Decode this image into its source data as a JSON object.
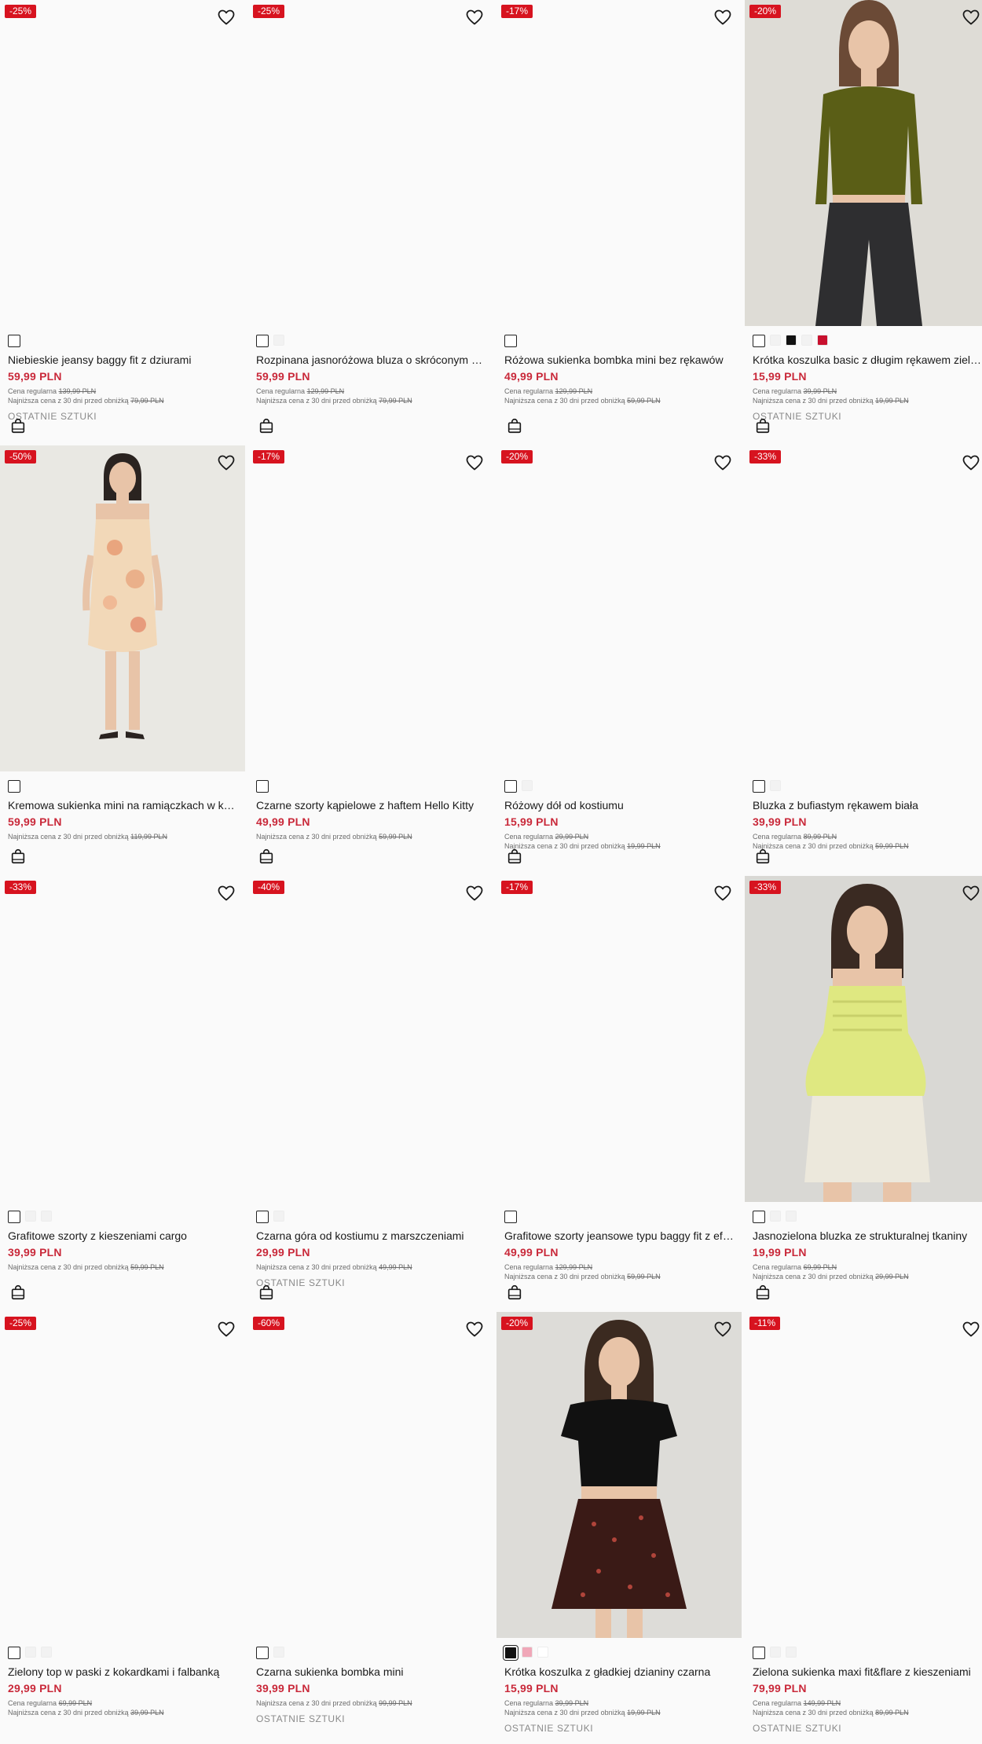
{
  "colors": {
    "badge": "#d7131f",
    "price": "#c9293a",
    "text": "#1a1a1a",
    "muted": "#6b6b6b"
  },
  "labels": {
    "regular_price": "Cena regularna",
    "lowest_price": "Najniższa cena z 30 dni przed obniżką",
    "last_items": "OSTATNIE SZTUKI"
  },
  "products": [
    {
      "discount": "-25%",
      "title": "Niebieskie jeansy baggy fit z dziurami",
      "price": "59,99 PLN",
      "regular": "139,99 PLN",
      "lowest": "79,99 PLN",
      "last": true,
      "photo": "",
      "swatches": [
        "#ffffff"
      ]
    },
    {
      "discount": "-25%",
      "title": "Rozpinana jasnoróżowa bluza o skróconym kroju",
      "price": "59,99 PLN",
      "regular": "129,99 PLN",
      "lowest": "79,99 PLN",
      "last": false,
      "photo": "",
      "swatches": [
        "#ffffff",
        "#f2f2f2"
      ]
    },
    {
      "discount": "-17%",
      "title": "Różowa sukienka bombka mini bez rękawów",
      "price": "49,99 PLN",
      "regular": "129,99 PLN",
      "lowest": "59,99 PLN",
      "last": false,
      "photo": "",
      "swatches": [
        "#ffffff"
      ]
    },
    {
      "discount": "-20%",
      "title": "Krótka koszulka basic z długim rękawem zielona",
      "price": "15,99 PLN",
      "regular": "39,99 PLN",
      "lowest": "19,99 PLN",
      "last": true,
      "photo": "olive-top",
      "swatches": [
        "#ffffff",
        "#f2f2f2",
        "#111111",
        "#f2f2f2",
        "#c8102e"
      ]
    },
    {
      "discount": "-50%",
      "title": "Kremowa sukienka mini na ramiączkach w kwiaty",
      "price": "59,99 PLN",
      "regular": null,
      "lowest": "119,99 PLN",
      "last": false,
      "photo": "floral-dress",
      "swatches": [
        "#ffffff"
      ]
    },
    {
      "discount": "-17%",
      "title": "Czarne szorty kąpielowe z haftem Hello Kitty",
      "price": "49,99 PLN",
      "regular": null,
      "lowest": "59,99 PLN",
      "last": false,
      "photo": "",
      "swatches": [
        "#ffffff"
      ]
    },
    {
      "discount": "-20%",
      "title": "Różowy dół od kostiumu",
      "price": "15,99 PLN",
      "regular": "29,99 PLN",
      "lowest": "19,99 PLN",
      "last": false,
      "photo": "",
      "swatches": [
        "#ffffff",
        "#f2f2f2"
      ]
    },
    {
      "discount": "-33%",
      "title": "Bluzka z bufiastym rękawem biała",
      "price": "39,99 PLN",
      "regular": "89,99 PLN",
      "lowest": "59,99 PLN",
      "last": false,
      "photo": "",
      "swatches": [
        "#ffffff",
        "#f2f2f2"
      ]
    },
    {
      "discount": "-33%",
      "title": "Grafitowe szorty z kieszeniami cargo",
      "price": "39,99 PLN",
      "regular": null,
      "lowest": "59,99 PLN",
      "last": false,
      "photo": "",
      "swatches": [
        "#ffffff",
        "#f2f2f2",
        "#f2f2f2"
      ]
    },
    {
      "discount": "-40%",
      "title": "Czarna góra od kostiumu z marszczeniami",
      "price": "29,99 PLN",
      "regular": null,
      "lowest": "49,99 PLN",
      "last": true,
      "photo": "",
      "swatches": [
        "#ffffff",
        "#f2f2f2"
      ]
    },
    {
      "discount": "-17%",
      "title": "Grafitowe szorty jeansowe typu baggy fit z efektem",
      "price": "49,99 PLN",
      "regular": "129,99 PLN",
      "lowest": "59,99 PLN",
      "last": false,
      "photo": "",
      "swatches": [
        "#ffffff"
      ]
    },
    {
      "discount": "-33%",
      "title": "Jasnozielona bluzka ze strukturalnej tkaniny",
      "price": "19,99 PLN",
      "regular": "69,99 PLN",
      "lowest": "29,99 PLN",
      "last": false,
      "photo": "green-blouse",
      "swatches": [
        "#ffffff",
        "#f2f2f2",
        "#f2f2f2"
      ]
    },
    {
      "discount": "-25%",
      "title": "Zielony top w paski z kokardkami i falbanką",
      "price": "29,99 PLN",
      "regular": "69,99 PLN",
      "lowest": "39,99 PLN",
      "last": false,
      "photo": "",
      "swatches": [
        "#ffffff",
        "#f2f2f2",
        "#f2f2f2"
      ]
    },
    {
      "discount": "-60%",
      "title": "Czarna sukienka bombka mini",
      "price": "39,99 PLN",
      "regular": null,
      "lowest": "99,99 PLN",
      "last": true,
      "photo": "",
      "swatches": [
        "#ffffff",
        "#f2f2f2"
      ]
    },
    {
      "discount": "-20%",
      "title": "Krótka koszulka z gładkiej dzianiny czarna",
      "price": "15,99 PLN",
      "regular": "39,99 PLN",
      "lowest": "19,99 PLN",
      "last": true,
      "photo": "black-tee",
      "swatches": [
        "#111111",
        "#f0a7b8",
        "#ffffff"
      ]
    },
    {
      "discount": "-11%",
      "title": "Zielona sukienka maxi fit&flare z kieszeniami",
      "price": "79,99 PLN",
      "regular": "149,99 PLN",
      "lowest": "89,99 PLN",
      "last": true,
      "photo": "",
      "swatches": [
        "#ffffff",
        "#f2f2f2",
        "#f2f2f2"
      ]
    }
  ]
}
